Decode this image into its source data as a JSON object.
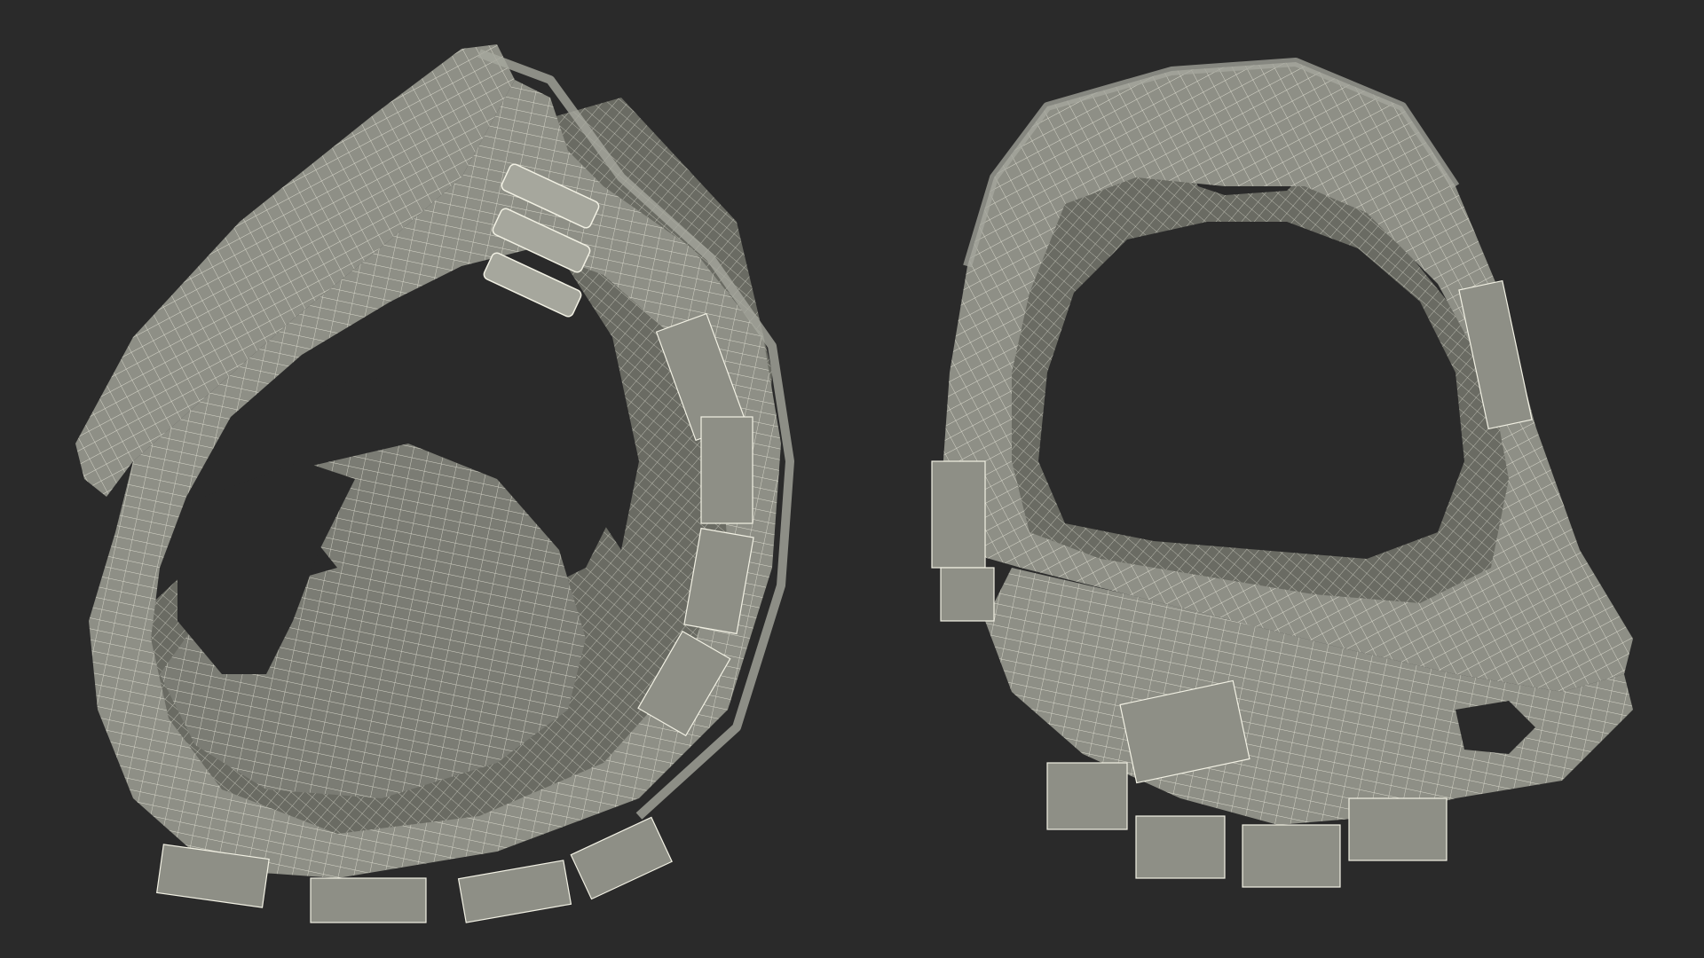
{
  "scene": {
    "background_color": "#2a2a2a",
    "surface_color": "#8e8f86",
    "surface_shadow_color": "#6a6b63",
    "surface_light_color": "#a6a79d",
    "wire_color": "#f2f1e4",
    "objects": [
      {
        "id": "vest-view-left",
        "description_icon": "wireframe-vest"
      },
      {
        "id": "vest-view-right",
        "description_icon": "wireframe-vest"
      }
    ]
  }
}
